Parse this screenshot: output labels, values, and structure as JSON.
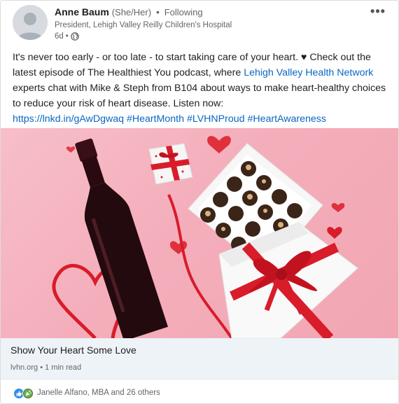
{
  "author": {
    "name": "Anne Baum",
    "pronouns": "(She/Her)",
    "separator": "•",
    "follow_status": "Following",
    "headline": "President, Lehigh Valley Reilly Children's Hospital",
    "time": "6d",
    "time_separator": "•"
  },
  "post": {
    "text_1": "It's never too early - or too late - to start taking care of your heart. ",
    "heart": "♥",
    "text_2": " Check out the latest episode of The Healthiest You podcast, where ",
    "mention": "Lehigh Valley Health Network",
    "text_3": " experts chat with Mike & Steph from B104 about ways to make heart-healthy choices to reduce your risk of heart disease. Listen now:",
    "url": "https://lnkd.in/gAwDgwaq",
    "hashtags": [
      "#HeartMonth",
      "#LVHNProud",
      "#HeartAwareness"
    ]
  },
  "preview": {
    "title": "Show Your Heart Some Love",
    "source": "lvhn.org",
    "separator": "•",
    "read_time": "1 min read"
  },
  "reactions": {
    "text": "Janelle Alfano, MBA and 26 others"
  },
  "icons": {
    "more": "more-options-icon",
    "globe": "globe-icon",
    "like": "like-reaction-icon",
    "celebrate": "celebrate-reaction-icon"
  },
  "colors": {
    "link": "#0a66c2",
    "preview_bg": "#eef3f8",
    "image_bg": "#f4aebb",
    "ribbon": "#d91c2a"
  }
}
